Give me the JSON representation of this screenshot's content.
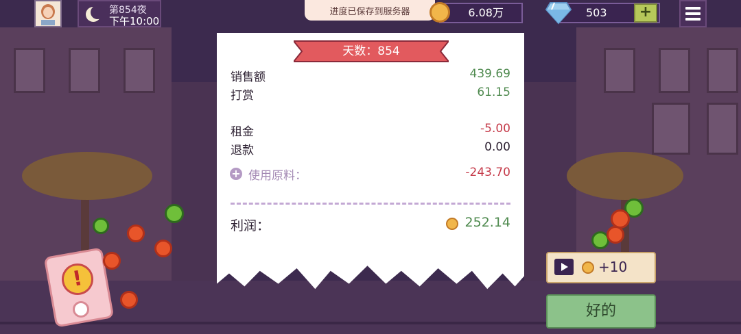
{
  "header": {
    "night_label": "第854夜",
    "time": "下午10:00",
    "save_toast": "进度已保存到服务器",
    "coins": "6.08万",
    "gems": "503",
    "plus_label": "+"
  },
  "receipt": {
    "day_banner": "天数：854",
    "rows": [
      {
        "label": "销售额",
        "value": "439.69"
      },
      {
        "label": "打赏",
        "value": "61.15"
      },
      {
        "label": "租金",
        "value": "-5.00"
      },
      {
        "label": "退款",
        "value": "0.00"
      }
    ],
    "ingredients": {
      "label": "使用原料：",
      "value": "-243.70"
    },
    "profit": {
      "label": "利润：",
      "value": "252.14"
    }
  },
  "buttons": {
    "ad_reward": "+10",
    "ok": "好的"
  },
  "colors": {
    "positive": "#4f8a4f",
    "negative": "#c53b4a",
    "banner": "#e25a5e",
    "ok_button": "#8cc28a"
  },
  "icons": [
    "moon-icon",
    "coin-icon",
    "diamond-icon",
    "plus-icon",
    "menu-icon",
    "video-icon",
    "alert-icon"
  ]
}
